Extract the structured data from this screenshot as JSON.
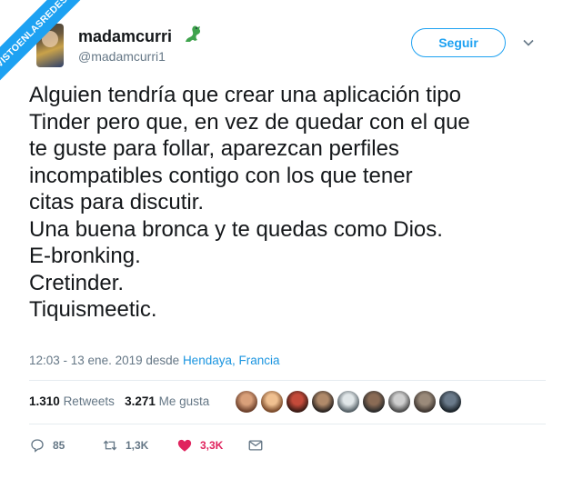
{
  "watermark": "VISTOENLASREDES",
  "user": {
    "name": "madamcurri",
    "handle": "@madamcurri1",
    "follow_label": "Seguir"
  },
  "tweet": {
    "text": "Alguien tendría que crear una aplicación tipo\nTinder pero que, en vez de quedar con el que\nte guste para follar,  aparezcan perfiles\nincompatibles contigo con los que tener\ncitas para discutir.\nUna buena bronca y te quedas como Dios.\nE-bronking.\nCretinder.\nTiquismeetic."
  },
  "meta": {
    "time": "12:03 - 13 ene. 2019",
    "from": "desde",
    "place": "Hendaya, Francia"
  },
  "stats": {
    "retweets_count": "1.310",
    "retweets_label": "Retweets",
    "likes_count": "3.271",
    "likes_label": "Me gusta"
  },
  "actions": {
    "replies": "85",
    "retweets": "1,3K",
    "likes": "3,3K"
  },
  "colors": {
    "accent": "#1da1f2",
    "like": "#e0245e",
    "secondary_text": "#657786"
  }
}
